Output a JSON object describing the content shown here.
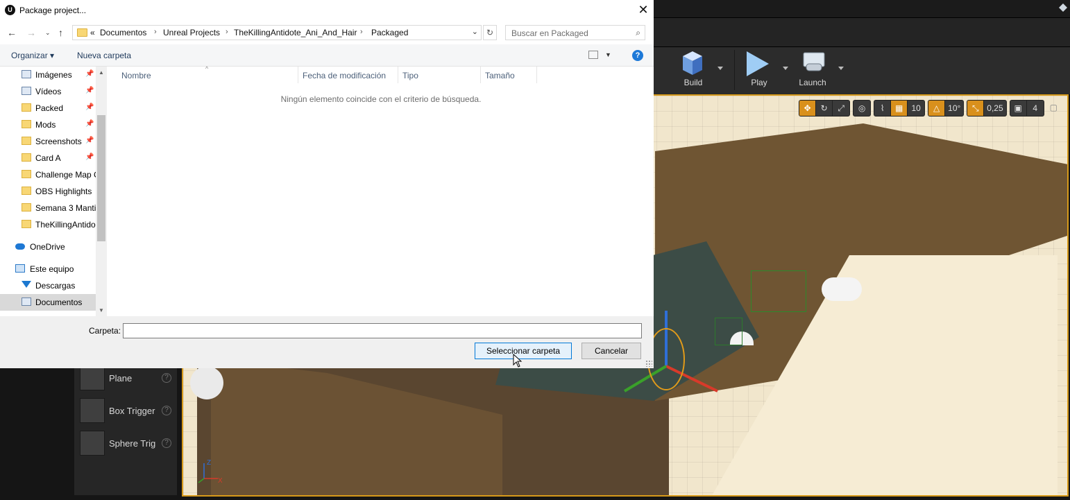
{
  "dialog": {
    "title": "Package project...",
    "app_icon": "unreal-logo-icon",
    "address": {
      "overflow": "«",
      "crumbs": [
        "Documentos",
        "Unreal Projects",
        "TheKillingAntidote_Ani_And_Hair",
        "Packaged"
      ]
    },
    "search_placeholder": "Buscar en Packaged",
    "commands": {
      "organize": "Organizar ▾",
      "new_folder": "Nueva carpeta"
    },
    "nav_items": [
      {
        "label": "Imágenes",
        "icon": "library-icon",
        "pinned": true
      },
      {
        "label": "Vídeos",
        "icon": "library-icon",
        "pinned": true
      },
      {
        "label": "Packed",
        "icon": "folder-icon",
        "pinned": true
      },
      {
        "label": "Mods",
        "icon": "folder-icon",
        "pinned": true
      },
      {
        "label": "Screenshots",
        "icon": "folder-icon",
        "pinned": true
      },
      {
        "label": "Card A",
        "icon": "folder-icon",
        "pinned": true
      },
      {
        "label": "Challenge Map C",
        "icon": "folder-icon",
        "pinned": false
      },
      {
        "label": "OBS Highlights",
        "icon": "folder-icon",
        "pinned": false
      },
      {
        "label": "Semana 3 Manti",
        "icon": "folder-icon",
        "pinned": false
      },
      {
        "label": "TheKillingAntido",
        "icon": "folder-icon",
        "pinned": false
      },
      {
        "label": "OneDrive",
        "icon": "onedrive-icon",
        "pinned": false
      },
      {
        "label": "Este equipo",
        "icon": "computer-icon",
        "pinned": false
      },
      {
        "label": "Descargas",
        "icon": "download-icon",
        "pinned": false
      },
      {
        "label": "Documentos",
        "icon": "document-icon",
        "pinned": false,
        "selected": true
      }
    ],
    "columns": [
      "Nombre",
      "Fecha de modificación",
      "Tipo",
      "Tamaño"
    ],
    "empty_message": "Ningún elemento coincide con el criterio de búsqueda.",
    "folder_label": "Carpeta:",
    "folder_value": "",
    "buttons": {
      "select": "Seleccionar carpeta",
      "cancel": "Cancelar"
    }
  },
  "editor": {
    "toolbar": [
      {
        "label": "Build",
        "icon": "build-icon"
      },
      {
        "label": "Play",
        "icon": "play-icon"
      },
      {
        "label": "Launch",
        "icon": "launch-icon"
      }
    ],
    "viewport_settings": {
      "grid_snap": "10",
      "rotation_snap": "10°",
      "scale_snap": "0,25",
      "camera_speed": "4"
    },
    "axis": {
      "z": "Z",
      "x": "X"
    },
    "place_actors": [
      "Plane",
      "Box Trigger",
      "Sphere Trig"
    ],
    "colors": {
      "accent": "#d79a1a",
      "dialog_primary": "#0078d7"
    }
  }
}
